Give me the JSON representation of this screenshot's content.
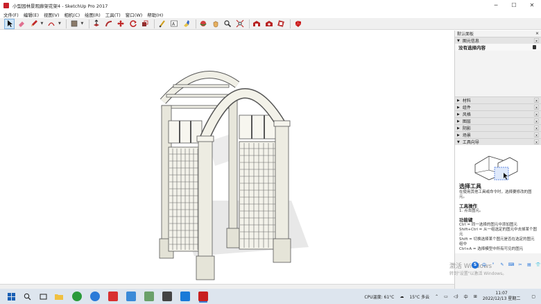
{
  "window": {
    "title": "小型园林景观廊架花架4 - SketchUp Pro 2017",
    "minimize": "─",
    "maximize": "☐",
    "close": "✕"
  },
  "menu": [
    "文件(F)",
    "编辑(E)",
    "视图(V)",
    "相机(C)",
    "绘图(R)",
    "工具(T)",
    "窗口(W)",
    "帮助(H)"
  ],
  "toolbar": {
    "tools": [
      "select-icon",
      "eraser-icon",
      "pencil-icon",
      "arc-icon",
      "paint-bucket-icon",
      "push-pull-icon",
      "follow-me-icon",
      "move-icon",
      "rotate-icon",
      "scale-icon",
      "tape-measure-icon",
      "text-icon",
      "paint-icon",
      "orbit-icon",
      "pan-icon",
      "zoom-icon",
      "zoom-extents-icon",
      "warehouse-icon",
      "extension-warehouse-icon",
      "layout-icon",
      "ruby-icon"
    ]
  },
  "panel": {
    "title": "默认面板",
    "entity_info": {
      "label": "图元信息",
      "value": "没有选择内容"
    },
    "sections": [
      "材料",
      "组件",
      "风格",
      "图层",
      "阴影",
      "场景",
      "工具向导"
    ],
    "instructor": {
      "tool_name": "选择工具",
      "tool_desc": "在使用其他工具或命令时，选择要修改的图元。",
      "ops_heading": "工具操作",
      "ops_text": "1. 点击图元。",
      "keys_heading": "功能键",
      "keys_text": [
        "Ctrl = 同一选择的图元中添加图元",
        "Shift+Ctrl = 从一组选定的图元中去掉某个图元",
        "Shift = 切换选择某个图元是否在选定的图元组中",
        "Ctrl+A = 选择模型中所有可见的图元"
      ]
    }
  },
  "watermark": {
    "activate": "激活 Windows",
    "activate_hint": "转到\"设置\"以激活 Windows。"
  },
  "ime": {
    "main": "S",
    "items": [
      "中",
      "°",
      "✎",
      "⌨",
      "✂",
      "▤",
      "👕",
      "⚙"
    ]
  },
  "taskbar": {
    "cpu": "CPU温度: 61°C",
    "weather": "15°C  多云",
    "time": "11:07",
    "date": "2022/12/13 星期二",
    "lang": "中"
  },
  "colors": {
    "accent": "#1d6fd8",
    "taskbar": "#dde5ee"
  }
}
